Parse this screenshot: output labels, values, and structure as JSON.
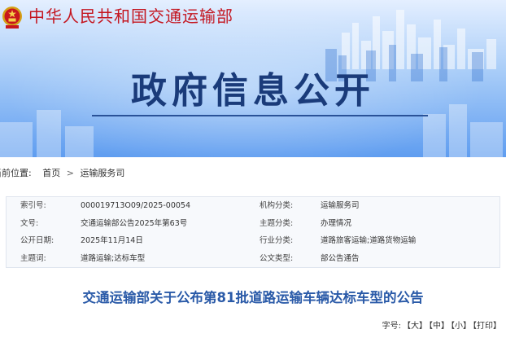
{
  "header": {
    "site_name": "中华人民共和国交通运输部",
    "section_title": "政府信息公开",
    "emblem_icon": "national-emblem-icon",
    "colors": {
      "site_name": "#c41620",
      "section_title": "#1a3b7a",
      "banner_top": "#e4efff",
      "banner_bottom": "#5f9df0"
    }
  },
  "breadcrumb": {
    "label": "当前位置:",
    "items": [
      "首页",
      "运输服务司"
    ],
    "separator": ">"
  },
  "info": {
    "rows": [
      {
        "label1": "索引号:",
        "value1": "000019713O09/2025-00054",
        "label2": "机构分类:",
        "value2": "运输服务司"
      },
      {
        "label1": "文号:",
        "value1": "交通运输部公告2025年第63号",
        "label2": "主题分类:",
        "value2": "办理情况"
      },
      {
        "label1": "公开日期:",
        "value1": "2025年11月14日",
        "label2": "行业分类:",
        "value2": "道路旅客运输;道路货物运输"
      },
      {
        "label1": "主题词:",
        "value1": "道路运输;达标车型",
        "label2": "公文类型:",
        "value2": "部公告通告"
      }
    ]
  },
  "article": {
    "title": "交通运输部关于公布第81批道路运输车辆达标车型的公告"
  },
  "tools": {
    "prefix": "字号:",
    "large": "【大】",
    "medium": "【中】",
    "small": "【小】",
    "print": "【打印】",
    "color": "#2a5aa8"
  }
}
